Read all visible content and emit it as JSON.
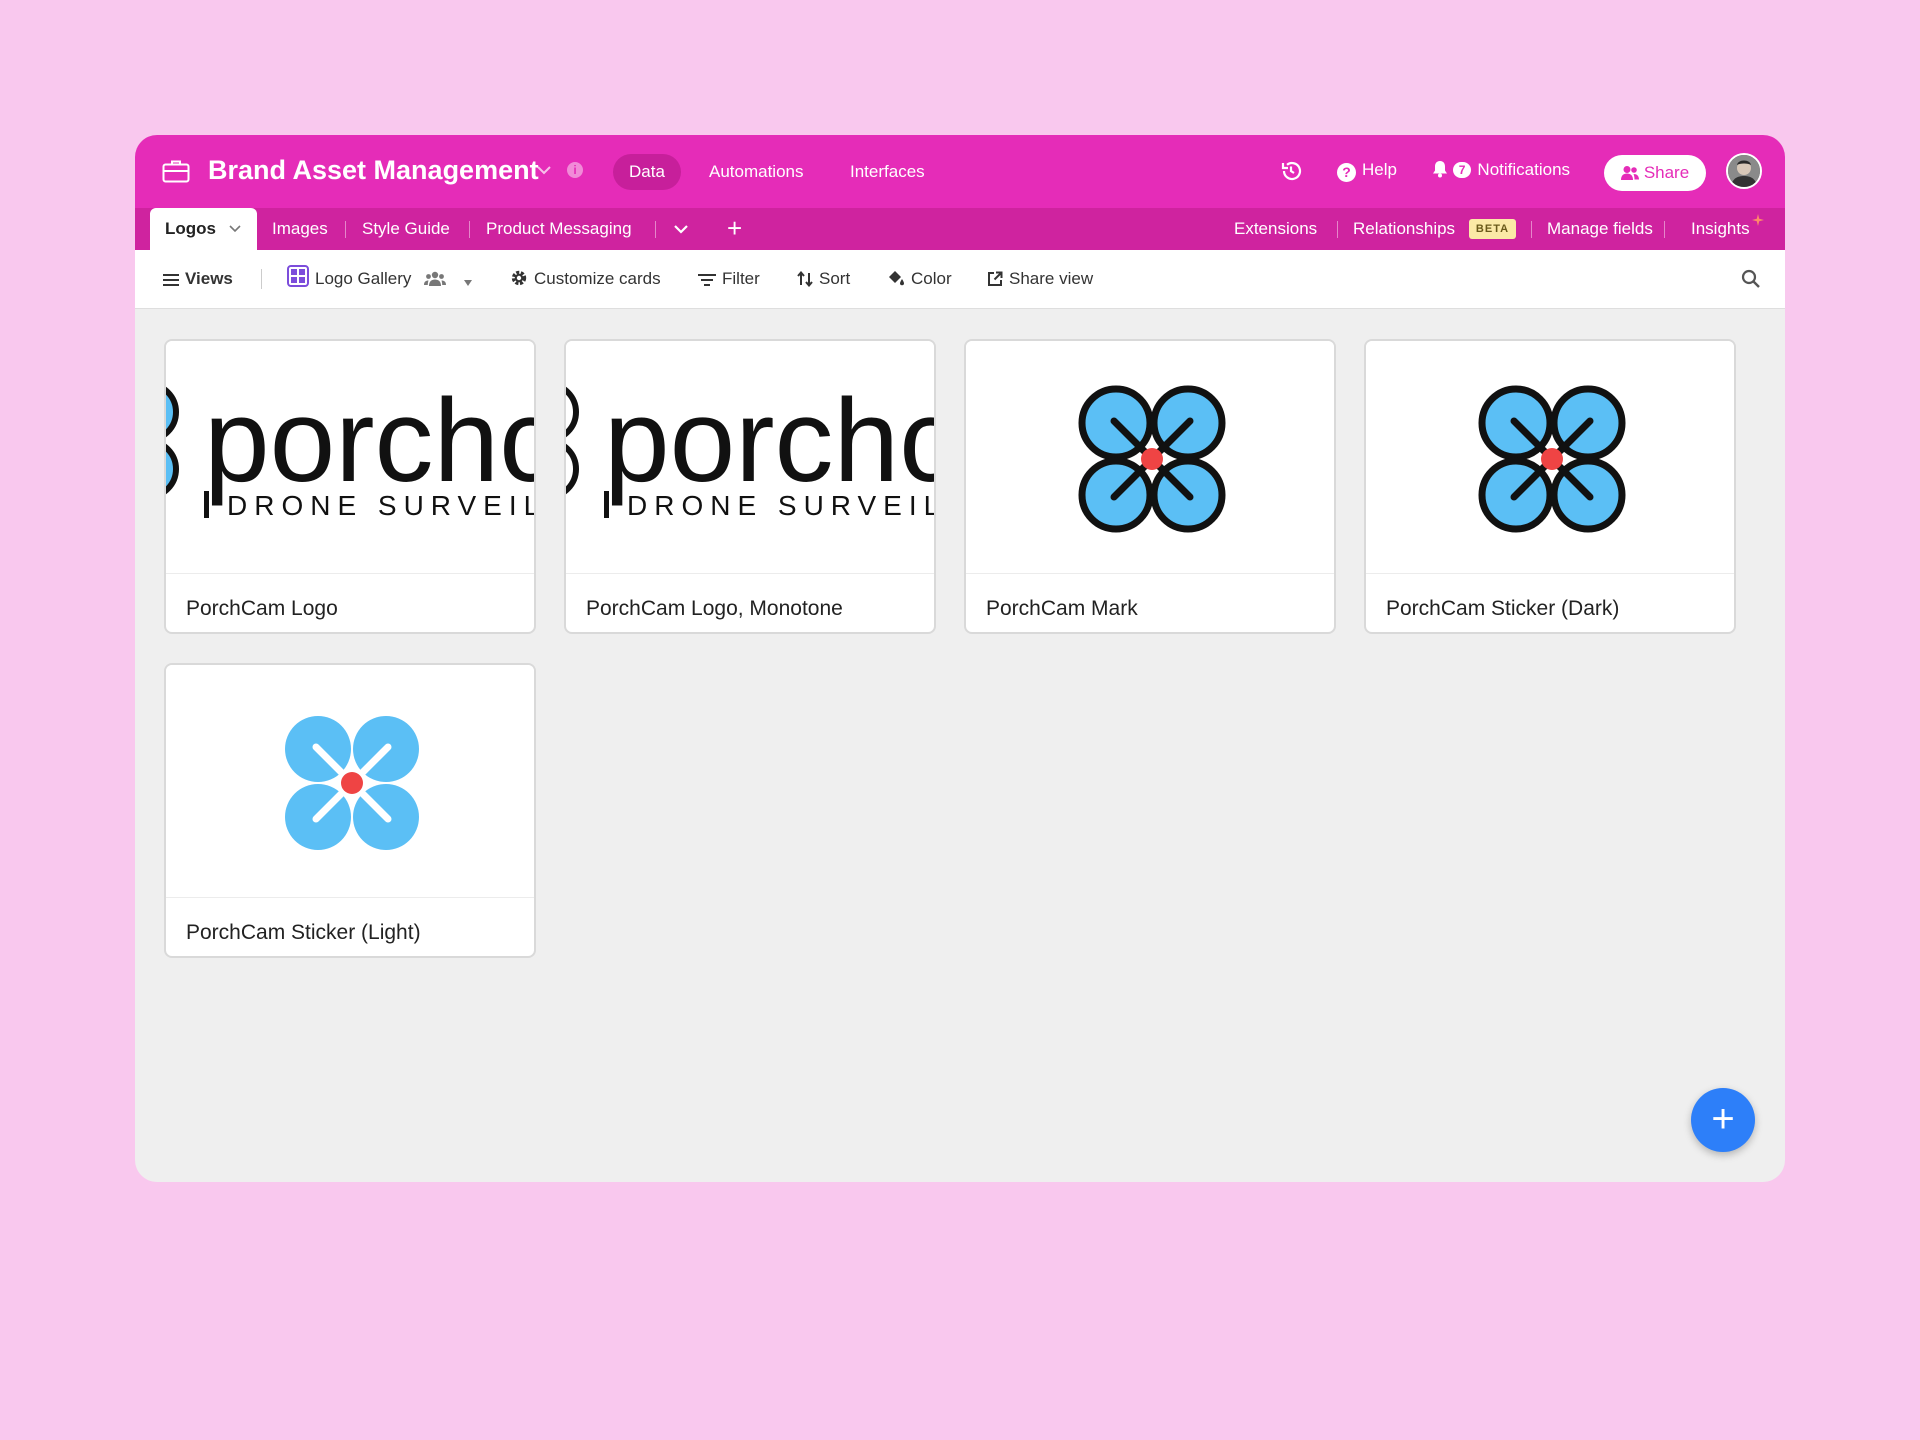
{
  "header": {
    "base_name": "Brand Asset Management",
    "nav_tabs": [
      {
        "label": "Data",
        "active": true
      },
      {
        "label": "Automations",
        "active": false
      },
      {
        "label": "Interfaces",
        "active": false
      }
    ],
    "help_label": "Help",
    "notifications_label": "Notifications",
    "notifications_count": "7",
    "share_label": "Share",
    "brand_color": "#e52cb8"
  },
  "tables": {
    "items": [
      {
        "label": "Logos",
        "active": true
      },
      {
        "label": "Images",
        "active": false
      },
      {
        "label": "Style Guide",
        "active": false
      },
      {
        "label": "Product Messaging",
        "active": false
      }
    ],
    "right_links": {
      "extensions": "Extensions",
      "relationships": "Relationships",
      "beta_badge": "BETA",
      "manage_fields": "Manage fields",
      "insights": "Insights"
    }
  },
  "viewbar": {
    "views_label": "Views",
    "view_name": "Logo Gallery",
    "customize_label": "Customize cards",
    "filter_label": "Filter",
    "sort_label": "Sort",
    "color_label": "Color",
    "share_view_label": "Share view"
  },
  "gallery": {
    "cards": [
      {
        "name": "PorchCam Logo",
        "cover": "wordmark",
        "wordmark": "porchca",
        "tagline": "DRONE SURVEILL"
      },
      {
        "name": "PorchCam Logo, Monotone",
        "cover": "wordmark",
        "wordmark": "porchca",
        "tagline": "DRONE SURVEILL"
      },
      {
        "name": "PorchCam Mark",
        "cover": "mark-dark"
      },
      {
        "name": "PorchCam Sticker (Dark)",
        "cover": "mark-dark"
      },
      {
        "name": "PorchCam Sticker (Light)",
        "cover": "mark-light"
      }
    ],
    "mark_blue": "#5bbff5",
    "mark_red": "#ef4444"
  },
  "fab_icon": "plus-icon"
}
